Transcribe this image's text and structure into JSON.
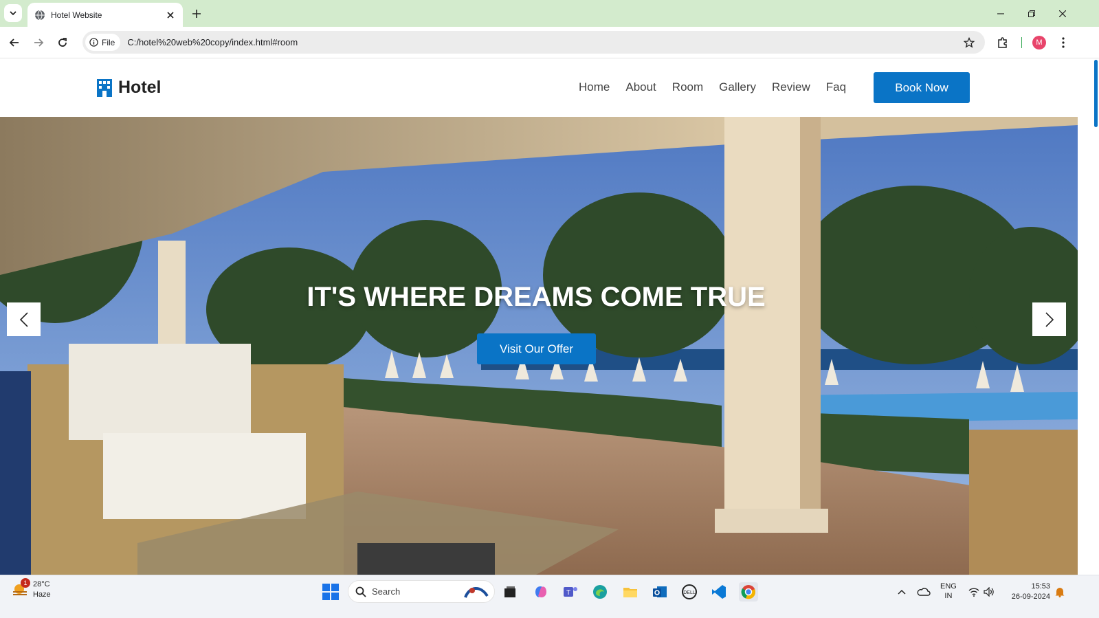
{
  "browser": {
    "tab_title": "Hotel Website",
    "url_chip": "File",
    "url": "C:/hotel%20web%20copy/index.html#room",
    "profile_initial": "M"
  },
  "site": {
    "logo_text": "Hotel",
    "nav": [
      "Home",
      "About",
      "Room",
      "Gallery",
      "Review",
      "Faq"
    ],
    "book_label": "Book Now",
    "accent": "#0a74c6"
  },
  "hero": {
    "title": "IT'S WHERE DREAMS COME TRUE",
    "button": "Visit Our Offer"
  },
  "taskbar": {
    "weather_temp": "28°C",
    "weather_desc": "Haze",
    "weather_badge": "1",
    "search_placeholder": "Search",
    "lang_top": "ENG",
    "lang_bottom": "IN",
    "time": "15:53",
    "date": "26-09-2024"
  }
}
